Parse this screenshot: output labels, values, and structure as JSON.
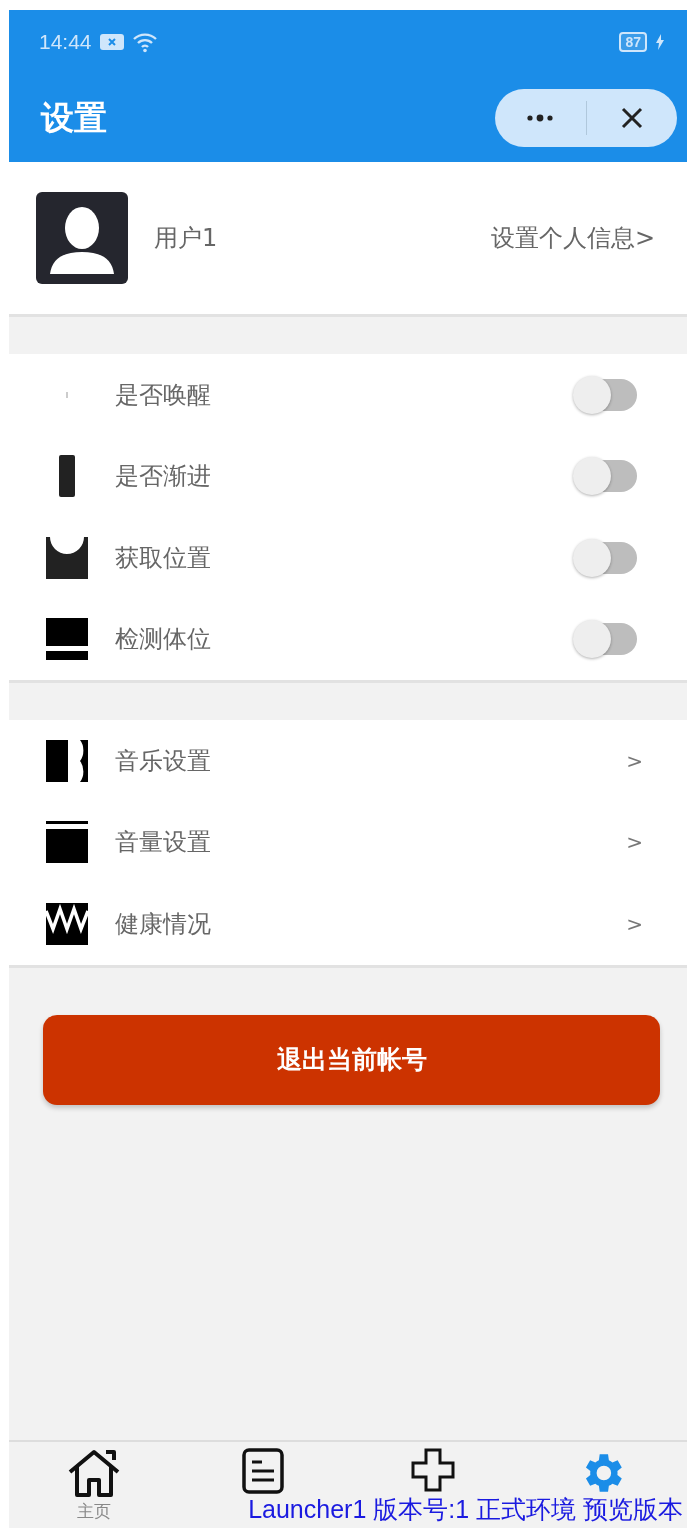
{
  "status_bar": {
    "time": "14:44",
    "battery": "87"
  },
  "header": {
    "title": "设置"
  },
  "profile": {
    "name": "用户1",
    "link": "设置个人信息>"
  },
  "toggles": [
    {
      "label": "是否唤醒",
      "on": false
    },
    {
      "label": "是否渐进",
      "on": false
    },
    {
      "label": "获取位置",
      "on": false
    },
    {
      "label": "检测体位",
      "on": false
    }
  ],
  "menu": [
    {
      "label": "音乐设置",
      "arrow": ">"
    },
    {
      "label": "音量设置",
      "arrow": ">"
    },
    {
      "label": "健康情况",
      "arrow": ">"
    }
  ],
  "logout_button": "退出当前帐号",
  "tab_bar": [
    {
      "label": "主页",
      "selected": false
    },
    {
      "selected": false
    },
    {
      "selected": false
    },
    {
      "selected": true
    }
  ],
  "version_overlay": "Launcher1 版本号:1 正式环境 预览版本"
}
